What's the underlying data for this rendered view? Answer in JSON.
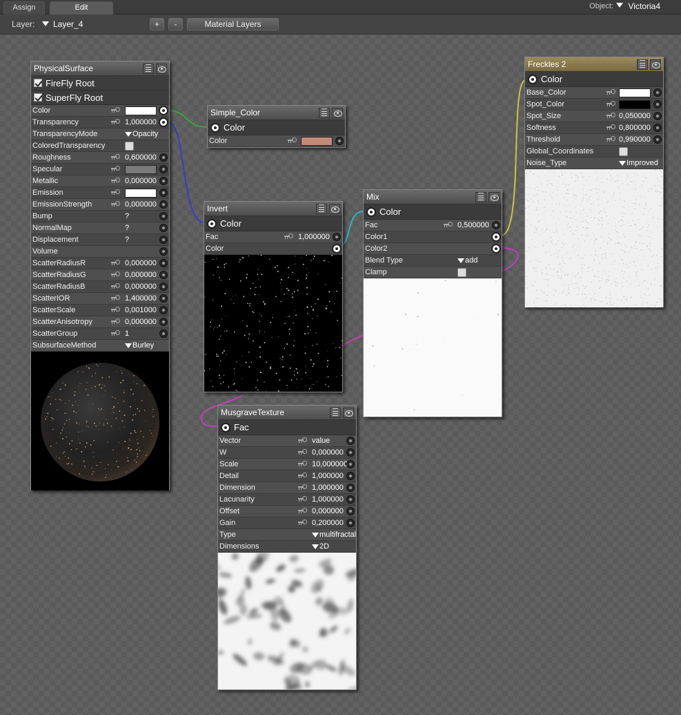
{
  "tabs": [
    {
      "label": "Assign",
      "active": false
    },
    {
      "label": "Edit",
      "active": true
    }
  ],
  "object": {
    "label": "Object:",
    "value": "Victoria4"
  },
  "toolbar": {
    "layer_label": "Layer:",
    "layer_value": "Layer_4",
    "add_label": "+",
    "remove_label": "-",
    "material_layers_label": "Material Layers"
  },
  "colors": {
    "simple_color_swatch": "#c48a78",
    "wire_green": "#3aa33a",
    "wire_blue": "#3a3acc",
    "wire_cyan": "#2ab8c0",
    "wire_yellow": "#c8c840",
    "wire_magenta": "#c040c0",
    "header_gold": "#8c7a4c"
  },
  "physical": {
    "title": "PhysicalSurface",
    "firefly": "FireFly Root",
    "superfly": "SuperFly Root",
    "rows": [
      {
        "label": "Color",
        "kind": "swatch",
        "color": "#ffffff",
        "out": true
      },
      {
        "label": "Transparency",
        "kind": "num",
        "value": "1,000000",
        "out": true
      },
      {
        "label": "TransparencyMode",
        "kind": "dd",
        "value": "Opacity"
      },
      {
        "label": "ColoredTransparency",
        "kind": "cb"
      },
      {
        "label": "Roughness",
        "kind": "num",
        "value": "0,600000",
        "sock": true
      },
      {
        "label": "Specular",
        "kind": "swatch",
        "color": "#7a7a7a",
        "sock": true
      },
      {
        "label": "Metallic",
        "kind": "num",
        "value": "0,000000",
        "sock": true
      },
      {
        "label": "Emission",
        "kind": "swatch",
        "color": "#ffffff",
        "sock": true
      },
      {
        "label": "EmissionStrength",
        "kind": "num",
        "value": "0,000000",
        "sock": true
      },
      {
        "label": "Bump",
        "kind": "q",
        "value": "?",
        "sock": true
      },
      {
        "label": "NormalMap",
        "kind": "q",
        "value": "?",
        "sock": true
      },
      {
        "label": "Displacement",
        "kind": "q",
        "value": "?",
        "sock": true
      },
      {
        "label": "Volume",
        "kind": "none",
        "sock": true
      },
      {
        "label": "ScatterRadiusR",
        "kind": "num",
        "value": "0,000000",
        "sock": true
      },
      {
        "label": "ScatterRadiusG",
        "kind": "num",
        "value": "0,000000",
        "sock": true
      },
      {
        "label": "ScatterRadiusB",
        "kind": "num",
        "value": "0,000000",
        "sock": true
      },
      {
        "label": "ScatterIOR",
        "kind": "num",
        "value": "1,400000",
        "sock": true
      },
      {
        "label": "ScatterScale",
        "kind": "num",
        "value": "0,001000",
        "sock": true
      },
      {
        "label": "ScatterAnisotropy",
        "kind": "num",
        "value": "0,000000",
        "sock": true
      },
      {
        "label": "ScatterGroup",
        "kind": "num",
        "value": "1",
        "sock": true
      },
      {
        "label": "SubsurfaceMethod",
        "kind": "dd",
        "value": "Burley"
      }
    ]
  },
  "simple": {
    "title": "Simple_Color",
    "output": "Color",
    "rows": [
      {
        "label": "Color",
        "kind": "swatch",
        "color": "#c48a78",
        "sock": true
      }
    ]
  },
  "invert": {
    "title": "Invert",
    "output": "Color",
    "rows": [
      {
        "label": "Fac",
        "kind": "num",
        "value": "1,000000",
        "sock": true
      },
      {
        "label": "Color",
        "kind": "none",
        "out": true
      }
    ]
  },
  "mix": {
    "title": "Mix",
    "output": "Color",
    "rows": [
      {
        "label": "Fac",
        "kind": "num",
        "value": "0,500000",
        "sock": true
      },
      {
        "label": "Color1",
        "kind": "none",
        "out": true
      },
      {
        "label": "Color2",
        "kind": "none",
        "out": true
      },
      {
        "label": "Blend Type",
        "kind": "dd",
        "value": "add"
      },
      {
        "label": "Clamp",
        "kind": "cb"
      }
    ]
  },
  "musgrave": {
    "title": "MusgraveTexture",
    "output": "Fac",
    "rows": [
      {
        "label": "Vector",
        "kind": "num",
        "value": "value",
        "sock": true
      },
      {
        "label": "W",
        "kind": "num",
        "value": "0,000000",
        "sock": true
      },
      {
        "label": "Scale",
        "kind": "num",
        "value": "10,000000",
        "sock": true
      },
      {
        "label": "Detail",
        "kind": "num",
        "value": "1,000000",
        "sock": true
      },
      {
        "label": "Dimension",
        "kind": "num",
        "value": "1,000000",
        "sock": true
      },
      {
        "label": "Lacunarity",
        "kind": "num",
        "value": "1,000000",
        "sock": true
      },
      {
        "label": "Offset",
        "kind": "num",
        "value": "0,000000",
        "sock": true
      },
      {
        "label": "Gain",
        "kind": "num",
        "value": "0,200000",
        "sock": true
      },
      {
        "label": "Type",
        "kind": "dd",
        "value": "multifractal"
      },
      {
        "label": "Dimensions",
        "kind": "dd",
        "value": "2D"
      }
    ]
  },
  "freckles": {
    "title": "Freckles 2",
    "output": "Color",
    "rows": [
      {
        "label": "Base_Color",
        "kind": "swatch",
        "color": "#ffffff",
        "sock": true
      },
      {
        "label": "Spot_Color",
        "kind": "swatch",
        "color": "#000000",
        "sock": true
      },
      {
        "label": "Spot_Size",
        "kind": "num",
        "value": "0,050000",
        "sock": true
      },
      {
        "label": "Softness",
        "kind": "num",
        "value": "0,800000",
        "sock": true
      },
      {
        "label": "Threshold",
        "kind": "num",
        "value": "0,990000",
        "sock": true
      },
      {
        "label": "Global_Coordinates",
        "kind": "cb"
      },
      {
        "label": "Noise_Type",
        "kind": "dd",
        "value": "Improved"
      }
    ]
  }
}
